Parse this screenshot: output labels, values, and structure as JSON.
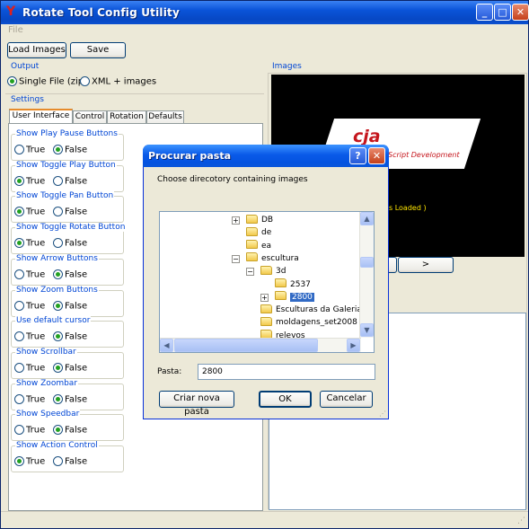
{
  "window": {
    "title": "Rotate Tool Config Utility",
    "logo_glyph": "Y",
    "minimize_glyph": "_",
    "maximize_glyph": "□",
    "close_glyph": "✕"
  },
  "menu": {
    "file": "File"
  },
  "toolbar": {
    "load_images": "Load Images",
    "save": "Save"
  },
  "output": {
    "label": "Output",
    "single_file": "Single File (zip)",
    "xml_images": "XML + images",
    "selected": "single_file"
  },
  "images": {
    "label": "Images",
    "status_fragment": "s Loaded )",
    "logo_text": "cja",
    "logo_subtext": "Script Development",
    "prev": "<",
    "next": ">"
  },
  "settings": {
    "label": "Settings",
    "tabs": [
      "User Interface",
      "Control",
      "Rotation",
      "Defaults"
    ],
    "active_tab": 0,
    "true_label": "True",
    "false_label": "False",
    "groups": [
      {
        "title": "Show Play Pause Buttons",
        "value": "False"
      },
      {
        "title": "Show Toggle Play Button",
        "value": "True"
      },
      {
        "title": "Show Toggle Pan Button",
        "value": "True"
      },
      {
        "title": "Show Toggle Rotate Button",
        "value": "True"
      },
      {
        "title": "Show Arrow Buttons",
        "value": "False"
      },
      {
        "title": "Show Zoom Buttons",
        "value": "False"
      },
      {
        "title": "Use default cursor",
        "value": "False"
      },
      {
        "title": "Show Scrollbar",
        "value": "False"
      },
      {
        "title": "Show Zoombar",
        "value": "False"
      },
      {
        "title": "Show Speedbar",
        "value": "False"
      },
      {
        "title": "Show Action Control",
        "value": "True"
      }
    ]
  },
  "dialog": {
    "title": "Procurar pasta",
    "help_glyph": "?",
    "close_glyph": "✕",
    "instruction": "Choose direcotory containing images",
    "tree": [
      {
        "label": "DB",
        "level": 0,
        "expander": "+"
      },
      {
        "label": "de",
        "level": 0,
        "expander": ""
      },
      {
        "label": "ea",
        "level": 0,
        "expander": ""
      },
      {
        "label": "escultura",
        "level": 0,
        "expander": "−"
      },
      {
        "label": "3d",
        "level": 1,
        "expander": "−"
      },
      {
        "label": "2537",
        "level": 2,
        "expander": ""
      },
      {
        "label": "2800",
        "level": 2,
        "expander": "+",
        "selected": true
      },
      {
        "label": "Esculturas da Galeria d",
        "level": 1,
        "expander": ""
      },
      {
        "label": "moldagens_set2008",
        "level": 1,
        "expander": ""
      },
      {
        "label": "relevos",
        "level": 1,
        "expander": ""
      }
    ],
    "scroll_up": "▲",
    "scroll_down": "▼",
    "scroll_left": "◀",
    "scroll_right": "▶",
    "folder_label": "Pasta:",
    "folder_value": "2800",
    "new_folder": "Criar nova pasta",
    "ok": "OK",
    "cancel": "Cancelar"
  }
}
